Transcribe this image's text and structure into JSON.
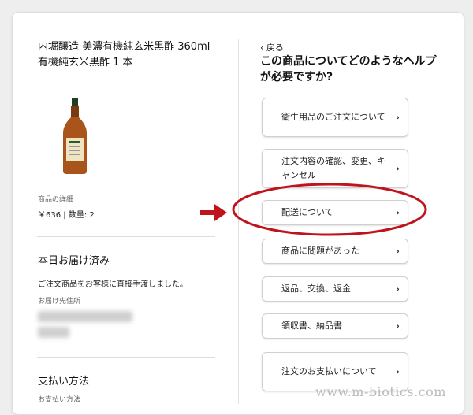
{
  "product": {
    "title": "内堀醸造 美濃有機純玄米黒酢 360ml 有機純玄米黒酢 1 本",
    "detail_label": "商品の詳細",
    "price_line": "￥636 | 数量: 2"
  },
  "delivery": {
    "section_title": "本日お届け済み",
    "message": "ご注文商品をお客様に直接手渡しました。",
    "address_label": "お届け先住所"
  },
  "payment": {
    "section_title": "支払い方法",
    "method_label": "お支払い方法"
  },
  "help": {
    "back_label": "‹ 戻る",
    "title": "この商品についてどのようなヘルプが必要ですか?",
    "options": [
      "衛生用品のご注文について",
      "注文内容の確認、変更、キャンセル",
      "配送について",
      "商品に問題があった",
      "返品、交換、返金",
      "領収書、納品書",
      "注文のお支払いについて"
    ],
    "chevron": "›"
  },
  "annotation": {
    "highlighted_option": "配送について",
    "color": "#c0141c"
  },
  "watermark": "www.m-biotics.com"
}
